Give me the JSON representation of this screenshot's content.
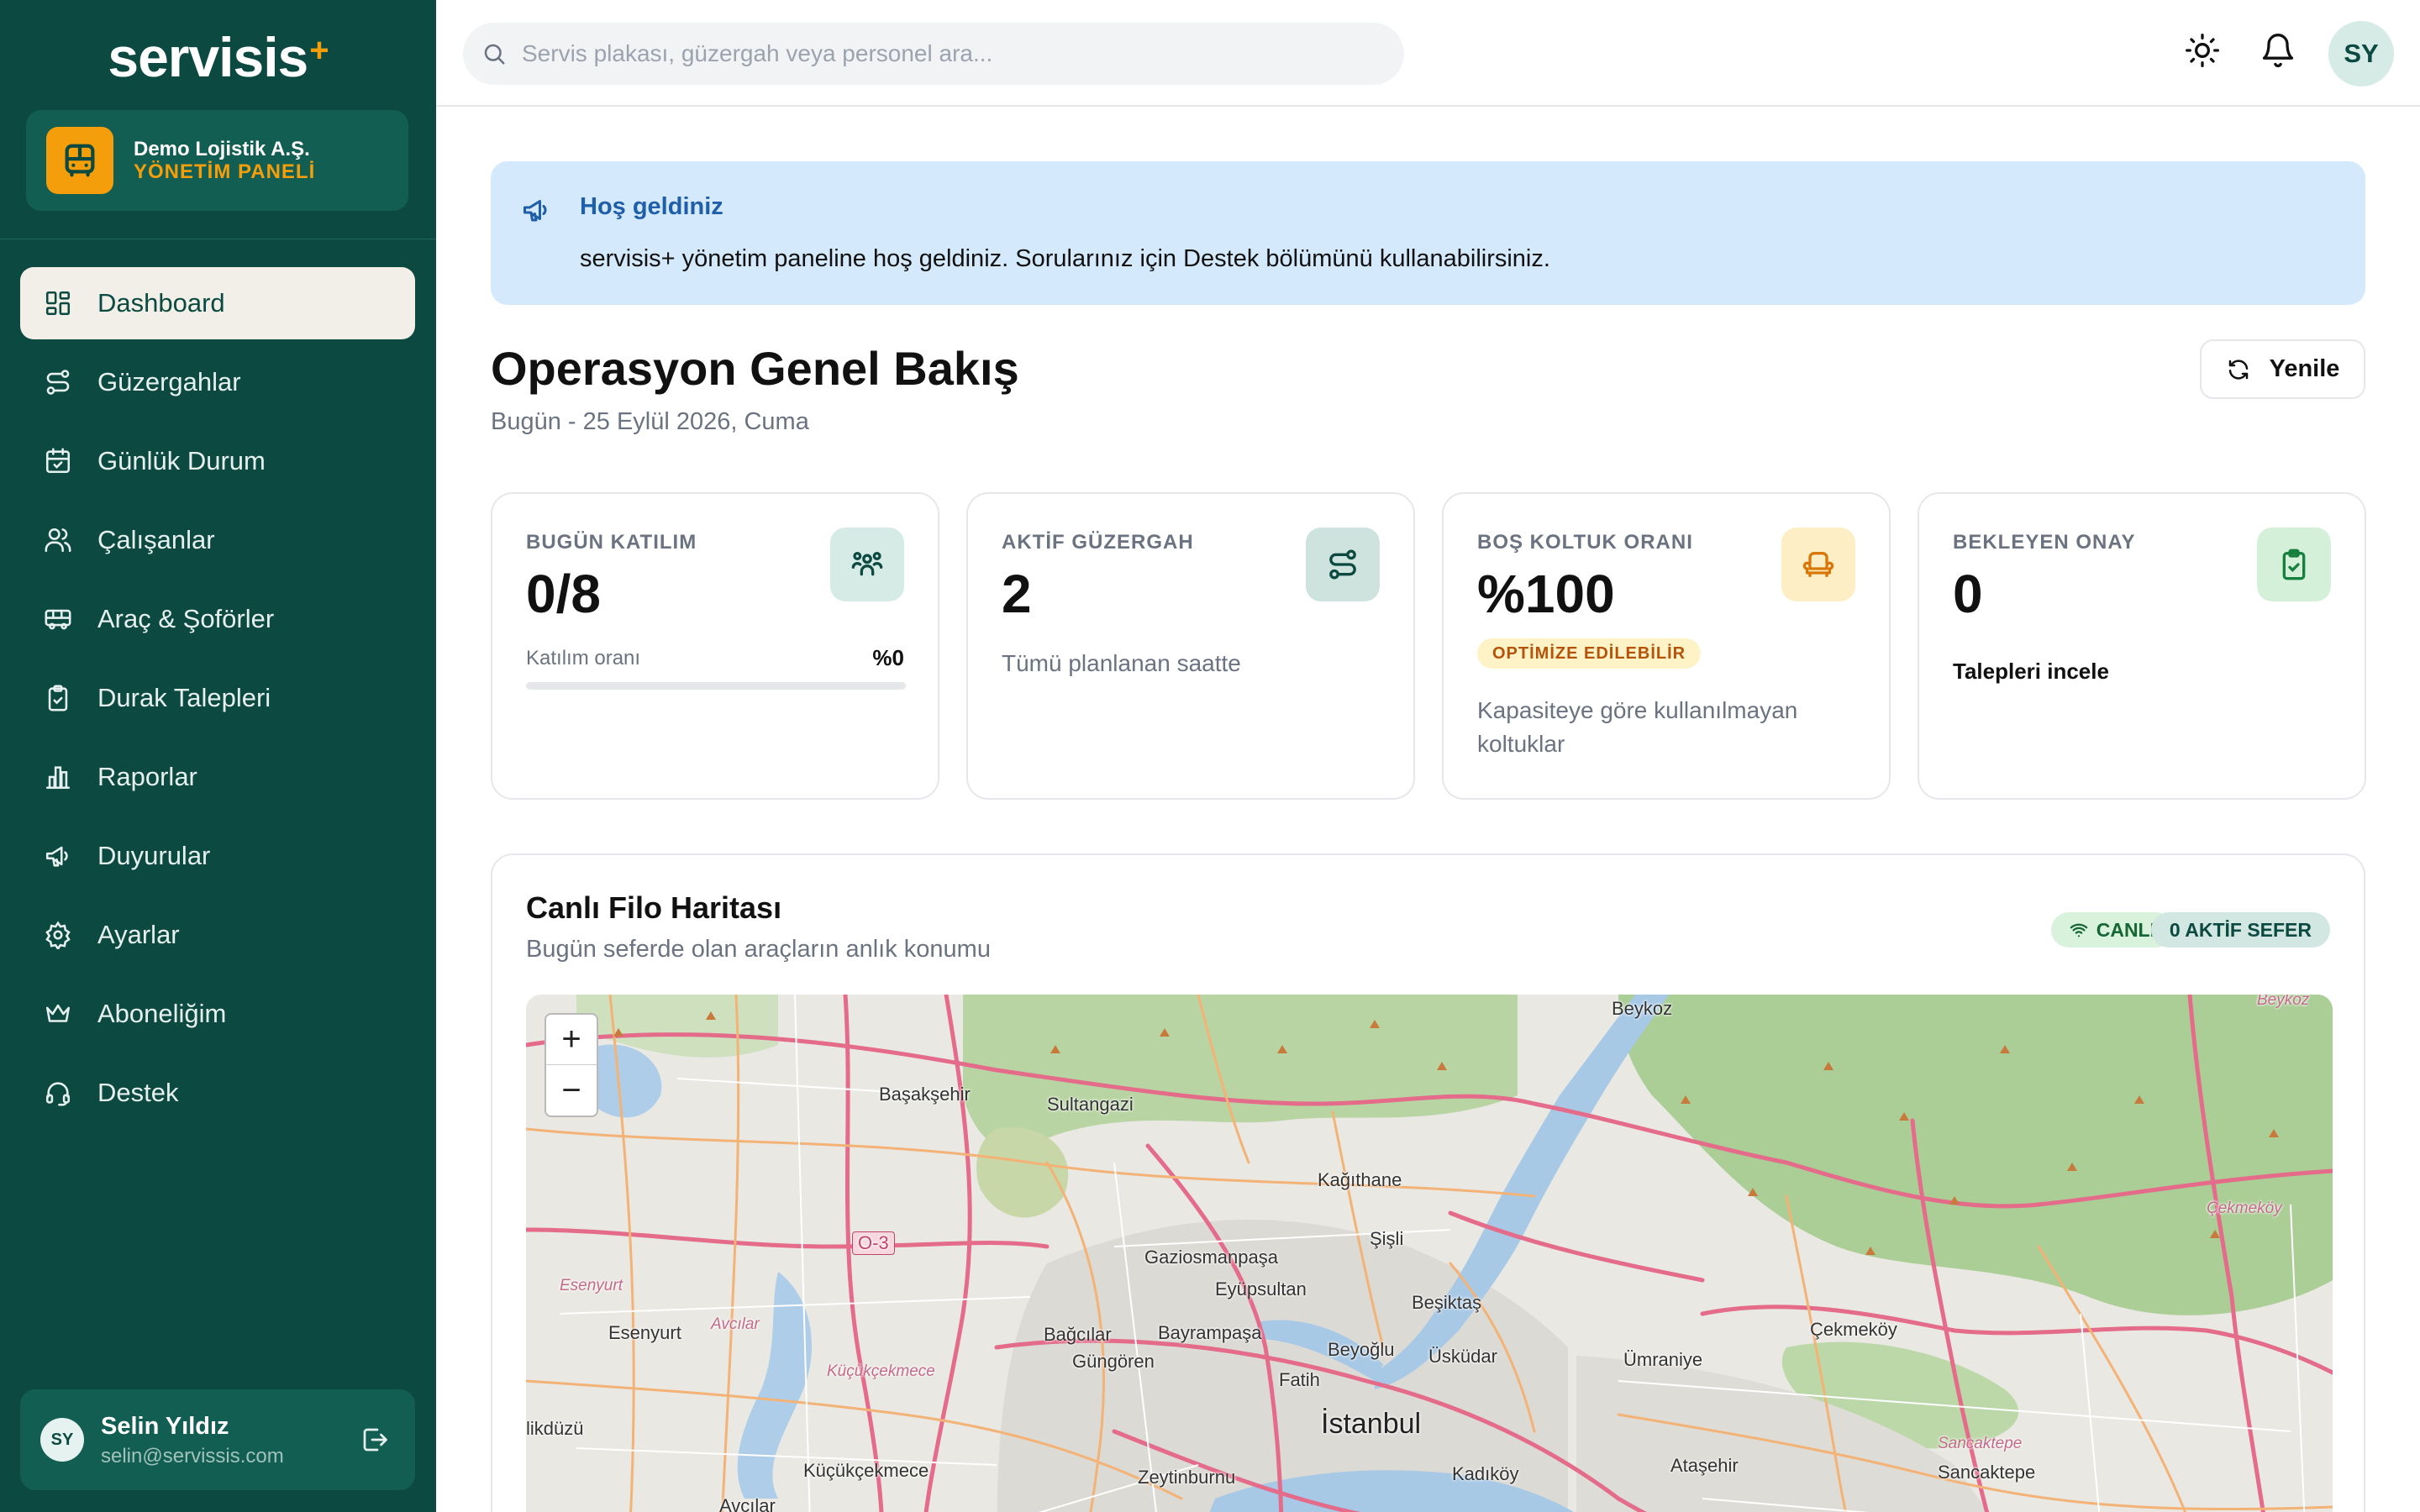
{
  "sidebar": {
    "logo_text": "servisis",
    "logo_mark": "+",
    "org_name": "Demo Lojistik A.Ş.",
    "org_subtitle": "YÖNETİM PANELİ",
    "nav": [
      {
        "label": "Dashboard",
        "icon": "dashboard-icon",
        "active": true
      },
      {
        "label": "Güzergahlar",
        "icon": "route-icon"
      },
      {
        "label": "Günlük Durum",
        "icon": "calendar-check-icon"
      },
      {
        "label": "Çalışanlar",
        "icon": "users-icon"
      },
      {
        "label": "Araç & Şoförler",
        "icon": "bus-icon"
      },
      {
        "label": "Durak Talepleri",
        "icon": "clipboard-check-icon"
      },
      {
        "label": "Raporlar",
        "icon": "bar-chart-icon"
      },
      {
        "label": "Duyurular",
        "icon": "megaphone-icon"
      },
      {
        "label": "Ayarlar",
        "icon": "gear-icon"
      },
      {
        "label": "Aboneliğim",
        "icon": "crown-icon"
      },
      {
        "label": "Destek",
        "icon": "headset-icon"
      }
    ],
    "user": {
      "initials": "SY",
      "name": "Selin Yıldız",
      "email": "selin@servissis.com"
    }
  },
  "topbar": {
    "search_placeholder": "Servis plakası, güzergah veya personel ara...",
    "avatar_initials": "SY"
  },
  "banner": {
    "title": "Hoş geldiniz",
    "text": "servisis+ yönetim paneline hoş geldiniz. Sorularınız için Destek bölümünü kullanabilirsiniz."
  },
  "header": {
    "title": "Operasyon Genel Bakış",
    "date": "Bugün - 25 Eylül 2026, Cuma",
    "refresh_label": "Yenile"
  },
  "cards": {
    "attendance": {
      "label": "BUGÜN KATILIM",
      "value": "0/8",
      "progress_label": "Katılım oranı",
      "progress_value": "%0",
      "progress": 0
    },
    "routes": {
      "label": "AKTİF GÜZERGAH",
      "value": "2",
      "desc": "Tümü planlanan saatte"
    },
    "empty_seats": {
      "label": "BOŞ KOLTUK ORANI",
      "value": "%100",
      "badge": "OPTİMİZE EDİLEBİLİR",
      "desc": "Kapasiteye göre kullanılmayan koltuklar"
    },
    "pending": {
      "label": "BEKLEYEN ONAY",
      "value": "0",
      "link": "Talepleri incele"
    }
  },
  "colors": {
    "primary": "#0c4a41",
    "accent": "#f59e0b",
    "banner_bg": "#d4e9fc"
  },
  "map": {
    "title": "Canlı Filo Haritası",
    "subtitle": "Bugün seferde olan araçların anlık konumu",
    "live_label": "CANLI",
    "active_label": "0 AKTİF SEFER",
    "zoom_in": "+",
    "zoom_out": "−",
    "places": [
      "Beykoz",
      "Başakşehir",
      "Sultangazi",
      "Kağıthane",
      "O-3",
      "Gaziosmanpaşa",
      "Şişli",
      "Eyüpsultan",
      "Esenyurt",
      "Esenyurt",
      "Avcılar",
      "Beşiktaş",
      "Çekmeköy",
      "Bağcılar",
      "Bayrampaşa",
      "Güngören",
      "Beyoğlu",
      "Üsküdar",
      "Ümraniye",
      "Küçükçekmece",
      "Fatih",
      "İstanbul",
      "likdüzü",
      "Küçükçekmece",
      "Zeytinburnu",
      "Kadıköy",
      "Ataşehir",
      "Sancaktepe",
      "Sancaktepe",
      "Avcılar",
      "Çekmeköy",
      "Beykoz"
    ]
  }
}
